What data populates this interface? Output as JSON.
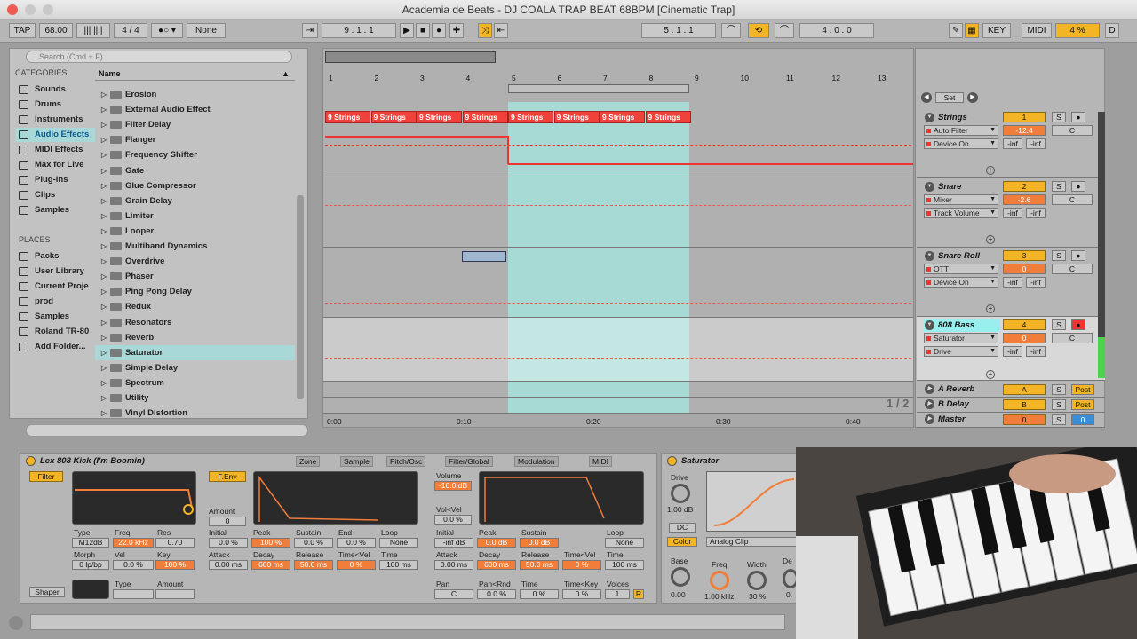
{
  "window": {
    "title": "Academia de Beats - DJ COALA TRAP BEAT 68BPM  [Cinematic Trap]"
  },
  "transport": {
    "tap": "TAP",
    "tempo": "68.00",
    "meter": "4 / 4",
    "quantize": "None",
    "position": "9 .  1 .  1",
    "loop_start": "5 .  1 .  1",
    "loop_length": "4 .  0 .  0",
    "key": "KEY",
    "midi": "MIDI",
    "cpu": "4 %",
    "d": "D"
  },
  "browser": {
    "search_placeholder": "Search (Cmd + F)",
    "categories_header": "CATEGORIES",
    "categories": [
      "Sounds",
      "Drums",
      "Instruments",
      "Audio Effects",
      "MIDI Effects",
      "Max for Live",
      "Plug-ins",
      "Clips",
      "Samples"
    ],
    "places_header": "PLACES",
    "places": [
      "Packs",
      "User Library",
      "Current Proje",
      "prod",
      "Samples",
      "Roland TR-80",
      "Add Folder..."
    ],
    "name_header": "Name",
    "items": [
      "Erosion",
      "External Audio Effect",
      "Filter Delay",
      "Flanger",
      "Frequency Shifter",
      "Gate",
      "Glue Compressor",
      "Grain Delay",
      "Limiter",
      "Looper",
      "Multiband Dynamics",
      "Overdrive",
      "Phaser",
      "Ping Pong Delay",
      "Redux",
      "Resonators",
      "Reverb",
      "Saturator",
      "Simple Delay",
      "Spectrum",
      "Utility",
      "Vinyl Distortion"
    ],
    "selected_item": "Saturator"
  },
  "arrangement": {
    "bars": [
      "1",
      "2",
      "3",
      "4",
      "5",
      "6",
      "7",
      "8",
      "9",
      "10",
      "11",
      "12",
      "13"
    ],
    "clip_label": "9 Strings",
    "time_labels": [
      "0:00",
      "0:10",
      "0:20",
      "0:30",
      "0:40"
    ],
    "page": "1 / 2",
    "set_label": "Set"
  },
  "tracks": [
    {
      "name": "Strings",
      "device": "Auto Filter",
      "param": "Device On",
      "num": "1",
      "vol": "-12.4",
      "pan": "C"
    },
    {
      "name": "Snare",
      "device": "Mixer",
      "param": "Track Volume",
      "num": "2",
      "vol": "-2.6",
      "pan": "C"
    },
    {
      "name": "Snare Roll",
      "device": "OTT",
      "param": "Device On",
      "num": "3",
      "vol": "0",
      "pan": "C"
    },
    {
      "name": "808 Bass",
      "device": "Saturator",
      "param": "Drive",
      "num": "4",
      "vol": "0",
      "pan": "C"
    }
  ],
  "returns": [
    {
      "name": "A Reverb",
      "num": "A",
      "post": "Post"
    },
    {
      "name": "B Delay",
      "num": "B",
      "post": "Post"
    },
    {
      "name": "Master",
      "num": "0",
      "post": "0"
    }
  ],
  "mixer_misc": {
    "inf": "-inf",
    "solo": "S"
  },
  "instrument": {
    "name": "Lex 808 Kick (I'm Boomin)",
    "tabs": [
      "Zone",
      "Sample",
      "Pitch/Osc",
      "Filter/Global",
      "Modulation",
      "MIDI"
    ],
    "filter_label": "Filter",
    "fenv_label": "F.Env",
    "type_label": "Type",
    "type": "M12dB",
    "freq_label": "Freq",
    "freq": "22.0 kHz",
    "res_label": "Res",
    "res": "0.70",
    "morph_label": "Morph",
    "morph": "0 lp/bp",
    "vel_label": "Vel",
    "vel": "0.0 %",
    "key_label": "Key",
    "key": "100 %",
    "amount_label": "Amount",
    "amount": "0",
    "env": {
      "initial_label": "Initial",
      "initial": "0.0 %",
      "peak_label": "Peak",
      "peak": "100 %",
      "sustain_label": "Sustain",
      "sustain": "0.0 %",
      "end_label": "End",
      "end": "0.0 %",
      "loop_label": "Loop",
      "loop": "None",
      "attack_label": "Attack",
      "attack": "0.00 ms",
      "decay_label": "Decay",
      "decay": "600 ms",
      "release_label": "Release",
      "release": "50.0 ms",
      "timevel_label": "Time<Vel",
      "timevel": "0 %",
      "time_label": "Time",
      "time": "100 ms"
    },
    "shaper_label": "Shaper",
    "shaper_type_label": "Type",
    "shaper_amount_label": "Amount",
    "volume_label": "Volume",
    "volume": "-10.0 dB",
    "volvel_label": "Vol<Vel",
    "volvel": "0.0 %",
    "amp": {
      "initial": "-inf dB",
      "peak": "0.0 dB",
      "sustain": "0.0 dB",
      "attack": "0.00 ms",
      "decay": "600 ms",
      "release": "50.0 ms",
      "timevel": "0 %",
      "time": "100 ms",
      "loop": "None"
    },
    "pan_label": "Pan",
    "pan": "C",
    "panrnd_label": "Pan<Rnd",
    "panrnd": "0.0 %",
    "time2_label": "Time",
    "time2": "0 %",
    "timekey_label": "Time<Key",
    "timekey": "0 %",
    "voices_label": "Voices",
    "voices": "1",
    "r_label": "R"
  },
  "saturator": {
    "name": "Saturator",
    "drive_label": "Drive",
    "drive": "1.00 dB",
    "dc": "DC",
    "color": "Color",
    "clip": "Analog Clip",
    "base_label": "Base",
    "base": "0.00",
    "freq_label": "Freq",
    "freq": "1.00 kHz",
    "width_label": "Width",
    "width": "30 %",
    "depth_label": "De",
    "depth": "0."
  },
  "colors": {
    "accent": "#f3b426",
    "clip": "#f0413a",
    "loop": "#a6dcd6",
    "selection": "#a8d8d8"
  }
}
